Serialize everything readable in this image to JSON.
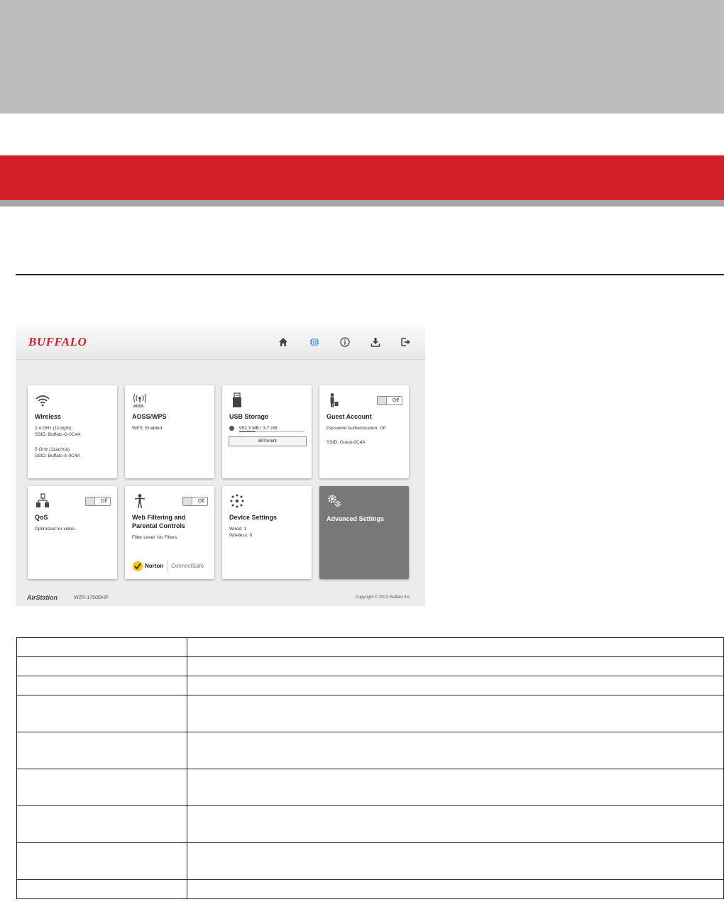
{
  "app": {
    "brand": "BUFFALO",
    "nav_icons": [
      "home-icon",
      "globe-icon",
      "info-icon",
      "download-icon",
      "logout-icon"
    ],
    "accent_color": "#d2202a",
    "tiles": {
      "wireless": {
        "title": "Wireless",
        "line1": "2.4 GHz (11n/g/b)",
        "line2": "SSID: Buffalo-G-0C4A",
        "line3": "5 GHz (11ac/n/a)",
        "line4": "SSID: Buffalo-A-0C4A"
      },
      "aoss": {
        "title": "AOSS/WPS",
        "icon_caption": "AOSS",
        "line1": "WPS: Enabled"
      },
      "usb": {
        "title": "USB Storage",
        "usage": "952.3 MB / 3.7 GB",
        "usage_fraction": 0.25,
        "button": "BitTorrent"
      },
      "guest": {
        "title": "Guest Account",
        "toggle": "Off",
        "line1": "Password Authentication: Off",
        "line2": "SSID: Guest-0C4A"
      },
      "qos": {
        "title": "QoS",
        "toggle": "Off",
        "line1": "Optimized for video."
      },
      "web_filter": {
        "title_line1": "Web Filtering and",
        "title_line2": "Parental Controls",
        "toggle": "Off",
        "line1": "Filter Level: No Filters",
        "norton": "Norton",
        "connectsafe": "ConnectSafe"
      },
      "device": {
        "title": "Device Settings",
        "line1": "Wired: 1",
        "line2": "Wireless: 0"
      },
      "advanced": {
        "title": "Advanced Settings"
      }
    },
    "footer": {
      "product": "AirStation",
      "model": "WZR-1750DHP",
      "copyright": "Copyright © 2013 Buffalo Inc."
    }
  },
  "table": {
    "row_count": 10
  }
}
